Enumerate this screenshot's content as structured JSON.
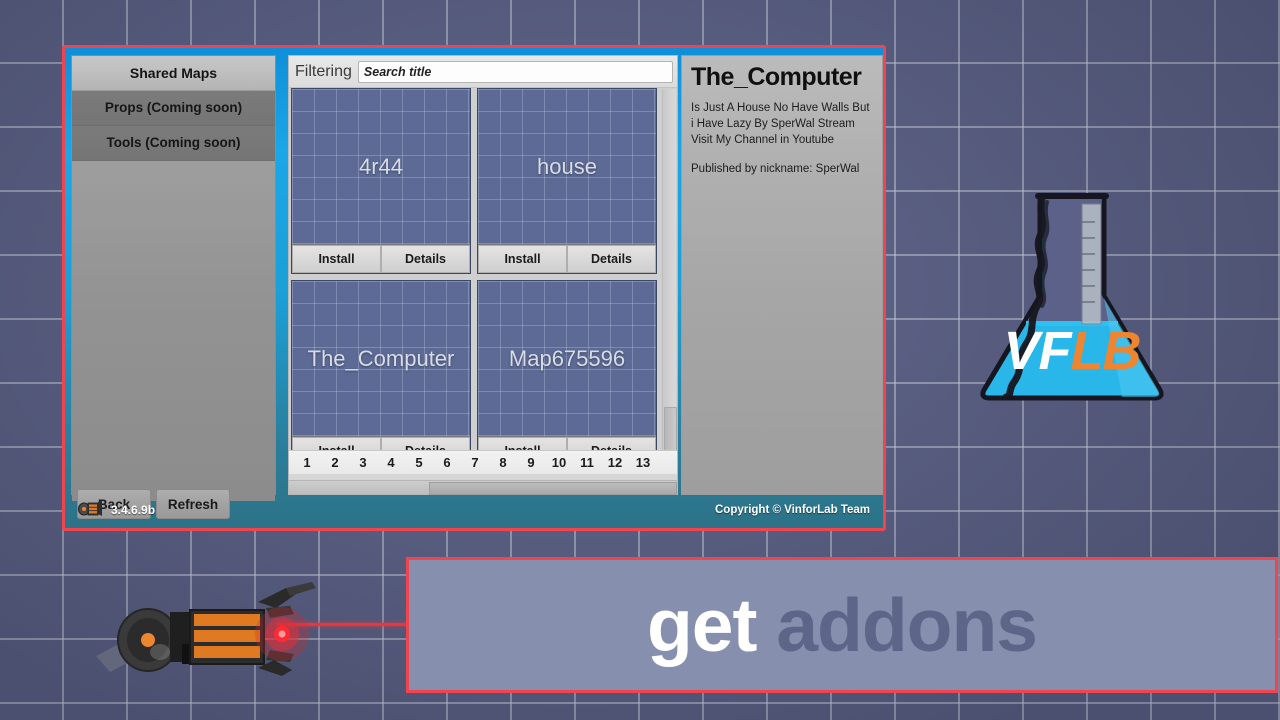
{
  "window": {
    "accent_border": "#f0454e",
    "frame_blue": "#1aa7e8"
  },
  "sidebar": {
    "header": "Shared Maps",
    "items": [
      {
        "label": "Props (Coming soon)"
      },
      {
        "label": "Tools (Coming soon)"
      }
    ],
    "buttons": [
      {
        "label": "Back"
      },
      {
        "label": "Refresh"
      }
    ]
  },
  "browse": {
    "filter_label": "Filtering",
    "search": {
      "value": "",
      "placeholder": "Search title"
    },
    "cards": [
      {
        "title": "4r44",
        "install_label": "Install",
        "details_label": "Details"
      },
      {
        "title": "house",
        "install_label": "Install",
        "details_label": "Details"
      },
      {
        "title": "The_Computer",
        "install_label": "Install",
        "details_label": "Details"
      },
      {
        "title": "Map675596",
        "install_label": "Install",
        "details_label": "Details"
      }
    ],
    "pagination": [
      "1",
      "2",
      "3",
      "4",
      "5",
      "6",
      "7",
      "8",
      "9",
      "10",
      "11",
      "12",
      "13"
    ]
  },
  "details": {
    "title": "The_Computer",
    "description": "Is Just A House No Have Walls But i Have Lazy By SperWal Stream Visit My Channel in Youtube",
    "publisher": "Published by nickname: SperWal"
  },
  "statusbar": {
    "version": "3.4.6.9b",
    "copyright": "Copyright © VinforLab Team"
  },
  "logo": {
    "part1": "VF",
    "part2": "LB",
    "liquid_color": "#29b6e8",
    "accent_color": "#ee8530"
  },
  "banner": {
    "word1": "get",
    "word2": "addons"
  }
}
